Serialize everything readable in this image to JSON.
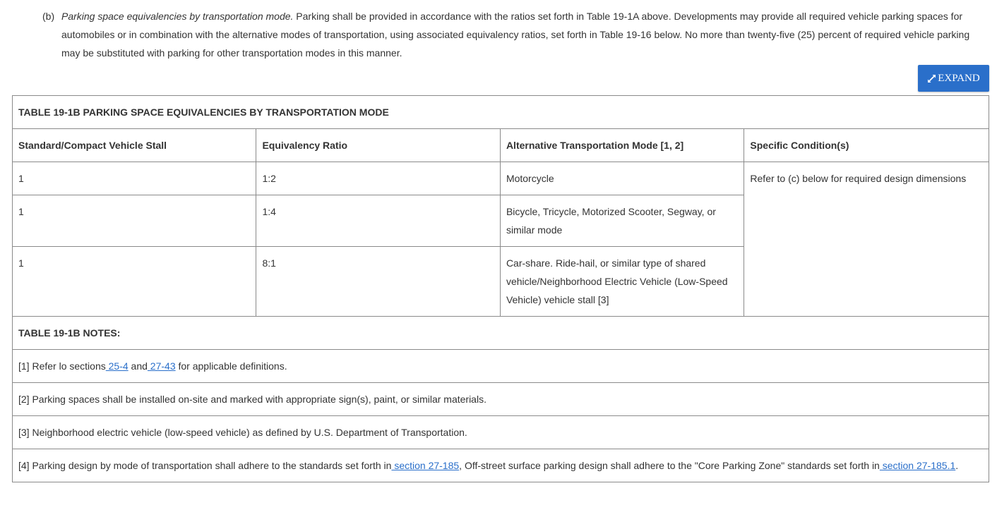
{
  "paragraph": {
    "number": "(b)",
    "italic_title": "Parking space equivalencies by transportation mode.",
    "body": " Parking shall be provided in accordance with the ratios set forth in Table 19-1A above. Developments may provide all required vehicle parking spaces for automobiles or in combination with the alternative modes of transportation, using associated equivalency ratios, set forth in Table 19-16 below. No more than twenty-five (25) percent of required vehicle parking may be substituted with parking for other transportation modes in this manner."
  },
  "expand_button": {
    "label": "EXPAND",
    "icon": "expand-arrows-icon",
    "color": "#2a6fca"
  },
  "table": {
    "caption": "TABLE 19-1B PARKING SPACE EQUIVALENCIES BY TRANSPORTATION MODE",
    "headers": [
      "Standard/Compact Vehicle Stall",
      "Equivalency Ratio",
      "Alternative Transportation Mode [1, 2]",
      "Specific Condition(s)"
    ],
    "rows": [
      {
        "stall": "1",
        "ratio": "1:2",
        "mode": "Motorcycle"
      },
      {
        "stall": "1",
        "ratio": "1:4",
        "mode": "Bicycle, Tricycle, Motorized Scooter, Segway, or similar mode"
      },
      {
        "stall": "1",
        "ratio": "8:1",
        "mode": "Car-share. Ride-hail, or similar type of shared vehicle/Neighborhood Electric Vehicle (Low-Speed Vehicle) vehicle stall [3]"
      }
    ],
    "condition": "Refer to (c) below for required design dimensions",
    "notes_title": "TABLE 19-1B NOTES:",
    "note1": {
      "prefix": "[1]  Refer lo sections",
      "link1": " 25-4",
      "middle": " and",
      "link2": " 27-43",
      "suffix": " for applicable definitions."
    },
    "note2": "[2]  Parking spaces shall be installed on-site and marked with appropriate sign(s), paint, or similar materials.",
    "note3": "[3]  Neighborhood electric vehicle (low-speed vehicle) as defined by U.S. Department of Transportation.",
    "note4": {
      "prefix": "[4]  Parking design by mode of transportation shall adhere to the standards set forth in",
      "link1": " section 27-185",
      "middle": ", Off-street surface parking design shall adhere to the \"Core Parking Zone\" standards set forth in",
      "link2": " section 27-185.1",
      "suffix": "."
    }
  }
}
